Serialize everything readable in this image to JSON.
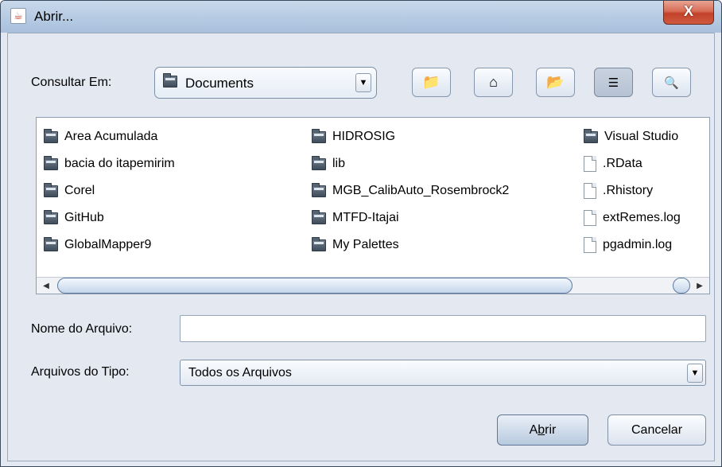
{
  "window": {
    "title": "Abrir...",
    "close_glyph": "X",
    "app_icon": "java-coffee-icon"
  },
  "look_in": {
    "label": "Consultar Em:",
    "value": "Documents",
    "toolbar": {
      "up_icon": "up-folder-icon",
      "home_icon": "home-icon",
      "new_folder_icon": "new-folder-icon",
      "list_view_icon": "list-view-icon",
      "details_view_icon": "details-view-icon"
    }
  },
  "files": {
    "columns": [
      [
        {
          "name": "Area Acumulada",
          "kind": "folder"
        },
        {
          "name": "bacia do itapemirim",
          "kind": "folder"
        },
        {
          "name": "Corel",
          "kind": "folder"
        },
        {
          "name": "GitHub",
          "kind": "folder"
        },
        {
          "name": "GlobalMapper9",
          "kind": "folder"
        }
      ],
      [
        {
          "name": "HIDROSIG",
          "kind": "folder"
        },
        {
          "name": "lib",
          "kind": "folder"
        },
        {
          "name": "MGB_CalibAuto_Rosembrock2",
          "kind": "folder"
        },
        {
          "name": "MTFD-Itajai",
          "kind": "folder"
        },
        {
          "name": "My Palettes",
          "kind": "folder"
        }
      ],
      [
        {
          "name": "Visual Studio",
          "kind": "folder"
        },
        {
          "name": ".RData",
          "kind": "file"
        },
        {
          "name": ".Rhistory",
          "kind": "file"
        },
        {
          "name": "extRemes.log",
          "kind": "file"
        },
        {
          "name": "pgadmin.log",
          "kind": "file"
        }
      ]
    ]
  },
  "filename": {
    "label": "Nome do Arquivo:",
    "value": ""
  },
  "filetype": {
    "label": "Arquivos do Tipo:",
    "value": "Todos os Arquivos"
  },
  "buttons": {
    "open_prefix": "A",
    "open_mnemonic": "b",
    "open_suffix": "rir",
    "cancel": "Cancelar"
  }
}
